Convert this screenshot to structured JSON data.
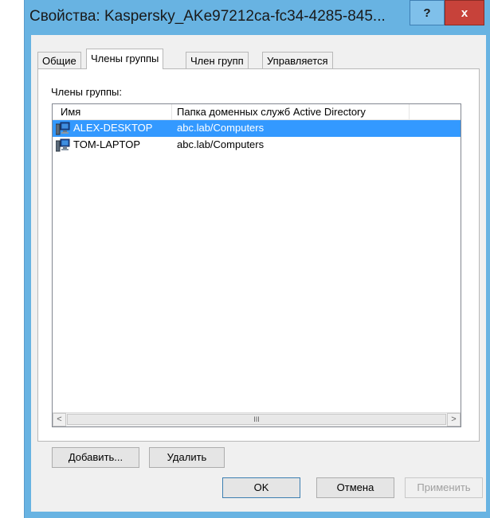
{
  "window": {
    "title": "Свойства: Kaspersky_AKe97212ca-fc34-4285-845...",
    "help_label": "?",
    "close_label": "x"
  },
  "tabs": [
    {
      "label": "Общие",
      "active": false
    },
    {
      "label": "Члены группы",
      "active": true
    },
    {
      "label": "Член групп",
      "active": false
    },
    {
      "label": "Управляется",
      "active": false
    }
  ],
  "members": {
    "section_label": "Члены группы:",
    "columns": [
      "Имя",
      "Папка доменных служб Active Directory"
    ],
    "rows": [
      {
        "name": "ALEX-DESKTOP",
        "folder": "abc.lab/Computers",
        "selected": true,
        "icon": "computer-icon"
      },
      {
        "name": "TOM-LAPTOP",
        "folder": "abc.lab/Computers",
        "selected": false,
        "icon": "computer-icon"
      }
    ],
    "scroll": {
      "left": "<",
      "right": ">",
      "thumb": "III"
    }
  },
  "actions": {
    "add": "Добавить...",
    "remove": "Удалить"
  },
  "footer": {
    "ok": "OK",
    "cancel": "Отмена",
    "apply": "Применить"
  },
  "colors": {
    "frame": "#68b3e2",
    "selection": "#3399ff",
    "close": "#c7423a"
  }
}
